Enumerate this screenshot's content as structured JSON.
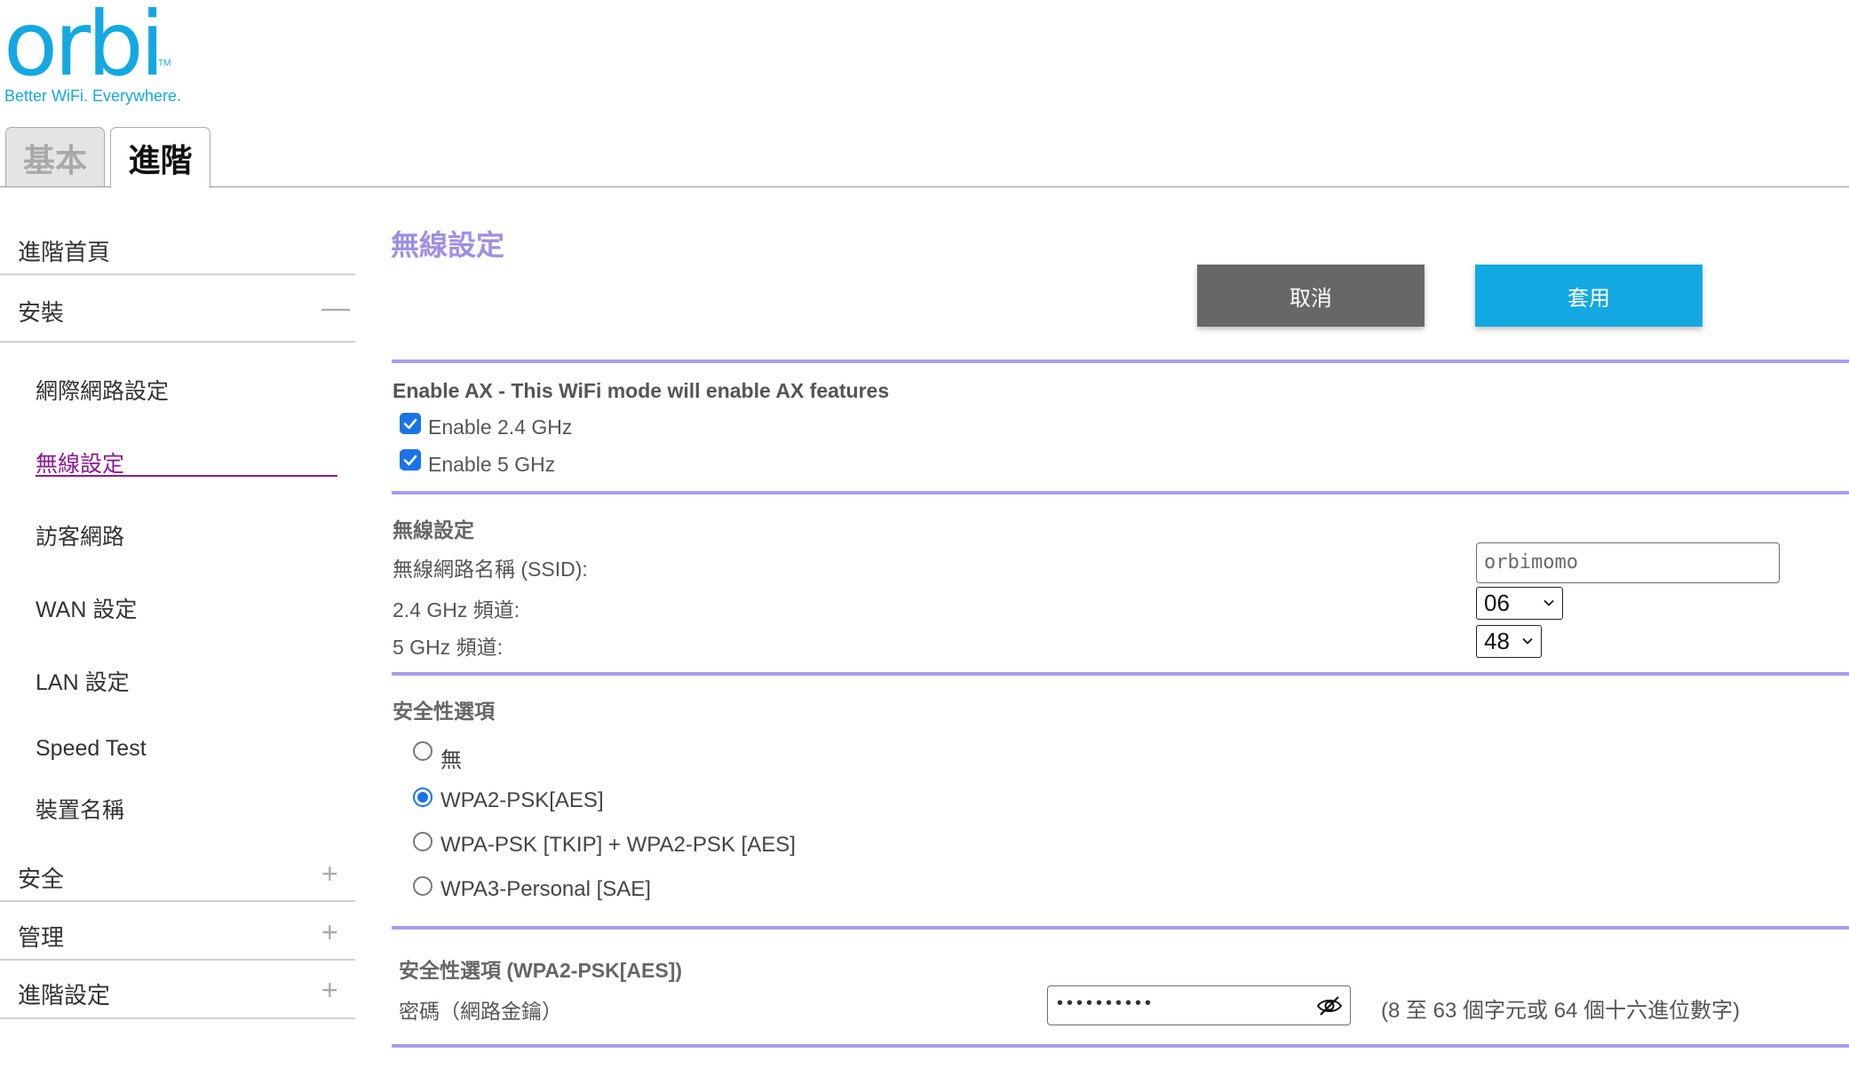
{
  "brand": {
    "logo_text": "orbi",
    "trademark": "TM",
    "tagline": "Better WiFi. Everywhere."
  },
  "tabs": [
    {
      "label": "基本",
      "active": false
    },
    {
      "label": "進階",
      "active": true
    }
  ],
  "sidebar": {
    "home": "進階首頁",
    "setup": {
      "label": "安裝",
      "toggle": "—"
    },
    "setup_items": [
      "網際網路設定",
      "無線設定",
      "訪客網路",
      "WAN 設定",
      "LAN 設定",
      "Speed Test",
      "裝置名稱"
    ],
    "active_item": "無線設定",
    "security": {
      "label": "安全",
      "toggle": "+"
    },
    "admin": {
      "label": "管理",
      "toggle": "+"
    },
    "advanced": {
      "label": "進階設定",
      "toggle": "+"
    }
  },
  "page": {
    "title": "無線設定",
    "cancel_label": "取消",
    "apply_label": "套用"
  },
  "ax": {
    "heading": "Enable AX - This WiFi mode will enable AX features",
    "enable_24": {
      "label": "Enable 2.4 GHz",
      "checked": true
    },
    "enable_5": {
      "label": "Enable 5 GHz",
      "checked": true
    }
  },
  "wireless": {
    "heading": "無線設定",
    "ssid_label": "無線網路名稱 (SSID):",
    "ssid_value": "orbimomo",
    "ch24_label": "2.4 GHz 頻道:",
    "ch24_value": "06",
    "ch5_label": "5 GHz 頻道:",
    "ch5_value": "48"
  },
  "security": {
    "heading": "安全性選項",
    "options": [
      "無",
      "WPA2-PSK[AES]",
      "WPA-PSK [TKIP] + WPA2-PSK [AES]",
      "WPA3-Personal [SAE]"
    ],
    "selected": "WPA2-PSK[AES]"
  },
  "psk": {
    "heading": "安全性選項 (WPA2-PSK[AES])",
    "password_label": "密碼（網路金鑰）",
    "password_mask": "••••••••••",
    "hint": "(8 至 63 個字元或 64 個十六進位數字)"
  },
  "colors": {
    "accent_purple": "#9f8fe4",
    "brand_blue": "#14a8e2",
    "active_nav": "#8a1a96",
    "cancel_gray": "#676767"
  }
}
